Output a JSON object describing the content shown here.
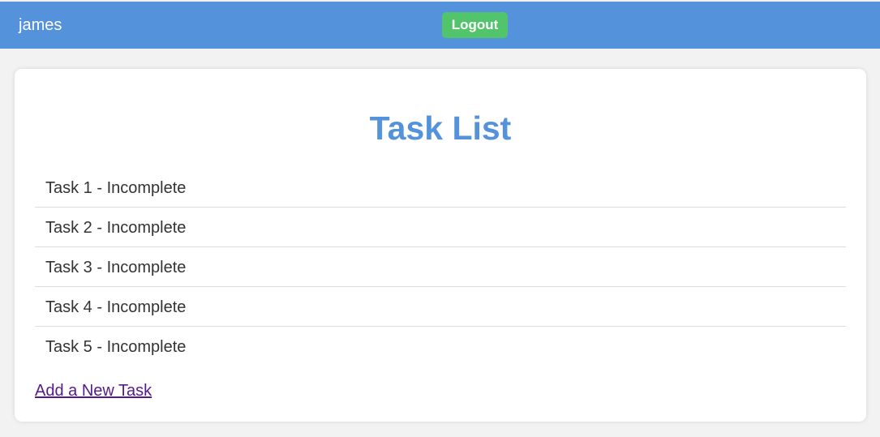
{
  "header": {
    "username": "james",
    "logout_label": "Logout"
  },
  "main": {
    "title": "Task List",
    "tasks": [
      {
        "label": "Task 1 - Incomplete"
      },
      {
        "label": "Task 2 - Incomplete"
      },
      {
        "label": "Task 3 - Incomplete"
      },
      {
        "label": "Task 4 - Incomplete"
      },
      {
        "label": "Task 5 - Incomplete"
      }
    ],
    "add_link_label": "Add a New Task"
  },
  "colors": {
    "header_bg": "#5592dc",
    "logout_bg": "#52c46b",
    "title": "#5592dc",
    "link": "#551a8b"
  }
}
